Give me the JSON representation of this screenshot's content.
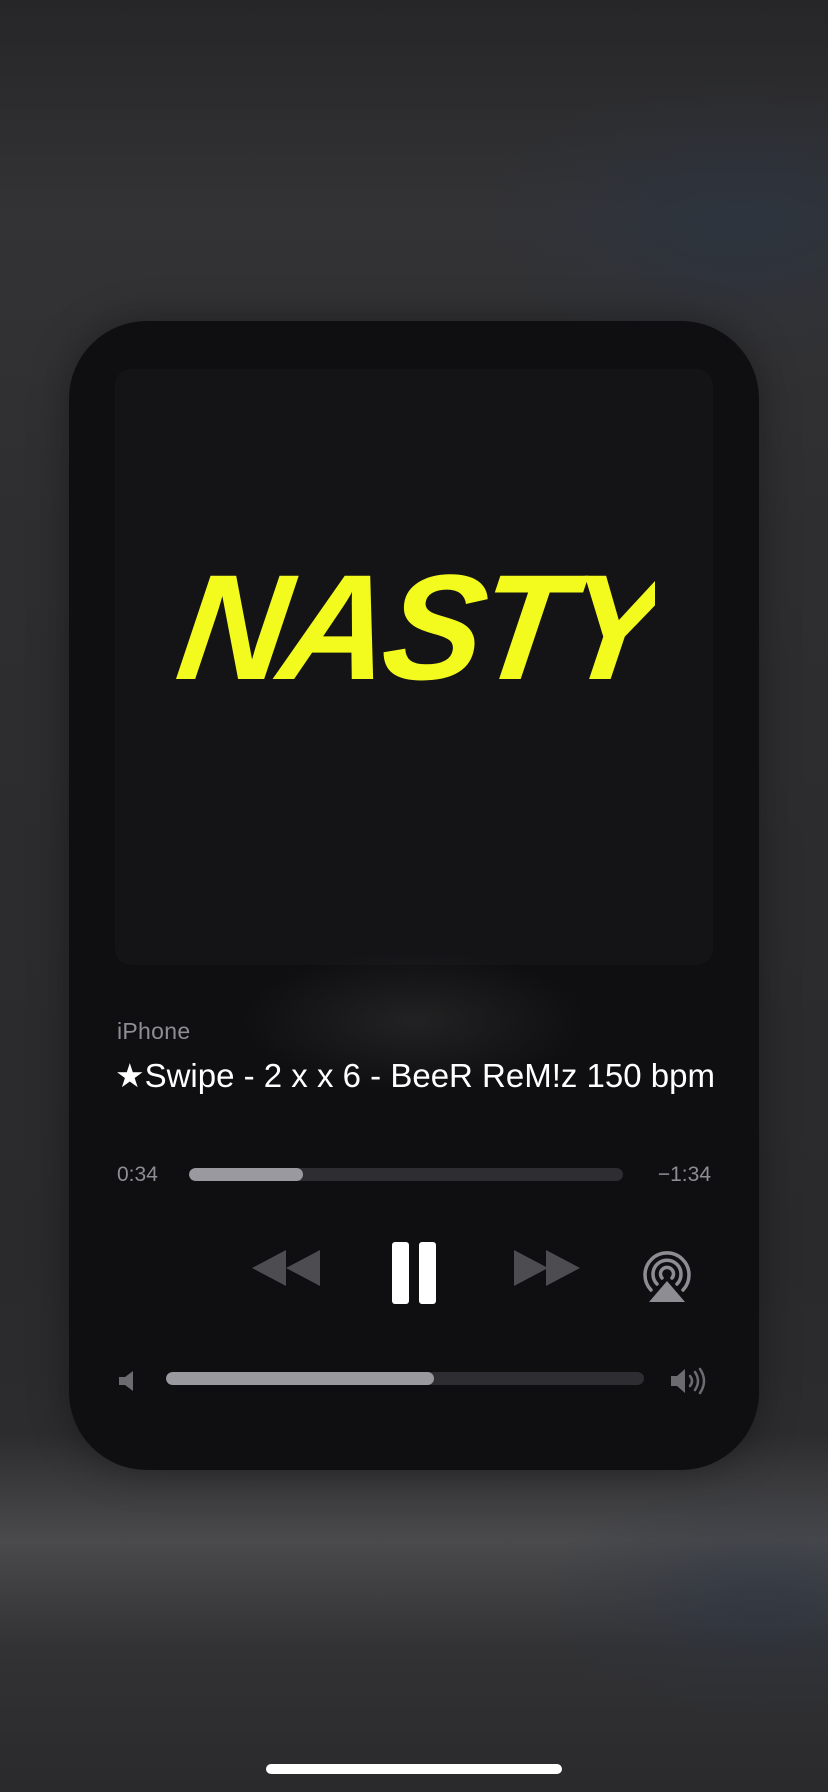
{
  "player": {
    "device_label": "iPhone",
    "track_title": "★Swipe - 2 x x 6 - BeeR ReM!z 150 bpm",
    "artwork_text": "NASTY",
    "elapsed": "0:34",
    "remaining": "−1:34",
    "progress_fraction": 0.263,
    "volume_fraction": 0.56
  },
  "icons": {
    "rewind": "rewind-icon",
    "pause": "pause-icon",
    "forward": "fast-forward-icon",
    "airplay": "airplay-icon",
    "volume_low": "speaker-low-icon",
    "volume_high": "speaker-high-icon"
  },
  "colors": {
    "artwork_text": "#f2fa1e",
    "card_background": "#0f0e10",
    "slider_fill": "#9a99a0",
    "slider_track": "#2e2d31"
  }
}
